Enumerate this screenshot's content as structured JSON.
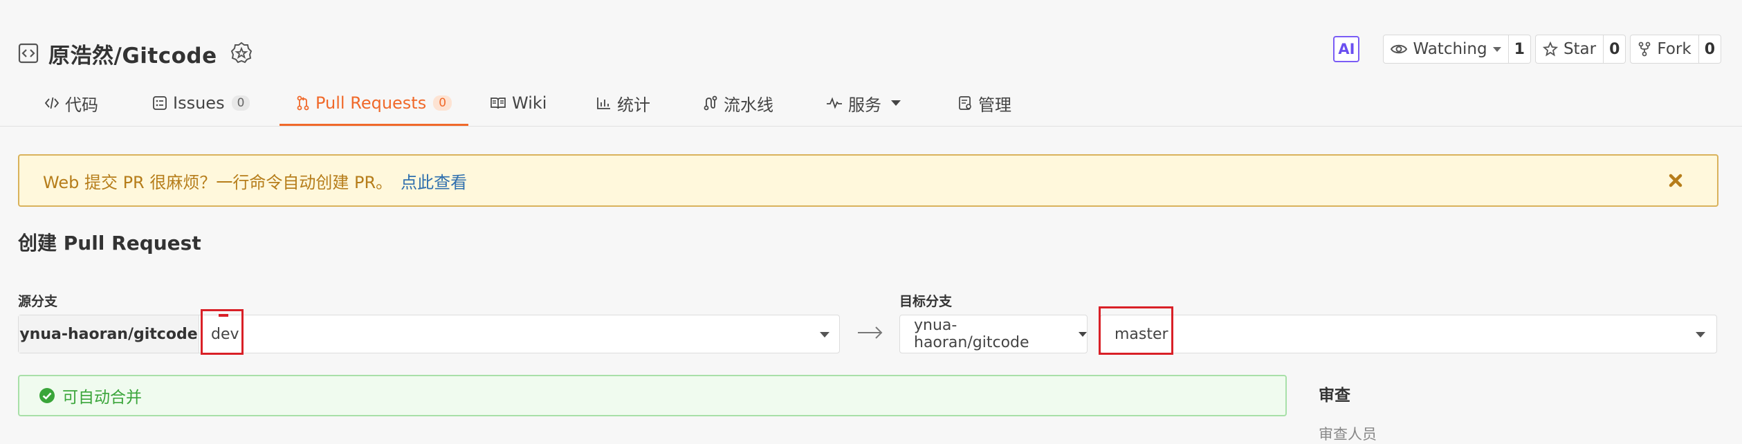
{
  "repo": {
    "title": "原浩然/Gitcode"
  },
  "actions": {
    "ai_label": "AI",
    "watch": {
      "label": "Watching",
      "count": "1"
    },
    "star": {
      "label": "Star",
      "count": "0"
    },
    "fork": {
      "label": "Fork",
      "count": "0"
    }
  },
  "tabs": [
    {
      "label": "代码"
    },
    {
      "label": "Issues",
      "count": "0"
    },
    {
      "label": "Pull Requests",
      "count": "0",
      "active": true
    },
    {
      "label": "Wiki"
    },
    {
      "label": "统计"
    },
    {
      "label": "流水线"
    },
    {
      "label": "服务"
    },
    {
      "label": "管理"
    }
  ],
  "notice": {
    "text": "Web 提交 PR 很麻烦？一行命令自动创建 PR。",
    "link": "点此查看"
  },
  "page_title": "创建 Pull Request",
  "source": {
    "label": "源分支",
    "repo": "ynua-haoran/gitcode",
    "branch": "dev"
  },
  "target": {
    "label": "目标分支",
    "repo": "ynua-haoran/gitcode",
    "branch": "master"
  },
  "merge_status": "可自动合并",
  "sidebar": {
    "review_title": "审查",
    "reviewer_label": "审查人员"
  },
  "colors": {
    "accent": "#f0692a",
    "success": "#3aa53a",
    "warning_text": "#b67d1a",
    "highlight": "#d92027"
  }
}
